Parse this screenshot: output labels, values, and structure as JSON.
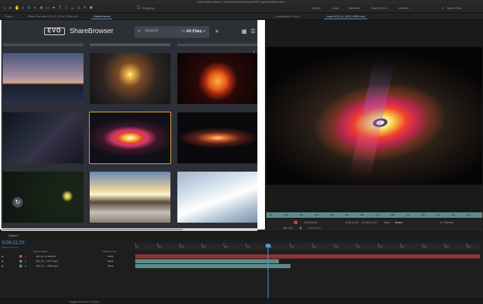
{
  "app": {
    "title": "Adobe After Effects - /Users/Andrew/Desktop/DNS Logo Animation.aep *"
  },
  "toolbar": {
    "snapping": "Snapping",
    "workspaces": [
      "Default",
      "Learn",
      "Standard",
      "Small Screen",
      "Libraries"
    ],
    "search_help": "Search Help"
  },
  "tabs": {
    "project": "Project",
    "effect_controls": "Effect Controls 003_01_4K19_0053.mp4",
    "sharebrowser": "ShareBrowser",
    "composition": "Composition Comp 1",
    "layer": "Layer 003_01_4K19_0053.mp4"
  },
  "sharebrowser": {
    "brand": "ShareBrowser",
    "logo_text": "EVO",
    "search_placeholder": "Search",
    "in_label": "In",
    "scope": "All Files"
  },
  "viewer": {
    "ruler": [
      "0s",
      "01s",
      "02s",
      "03s",
      "04s",
      "05s",
      "06s",
      "07s",
      "08s",
      "09s",
      "10s",
      "11s",
      "12s",
      "13s"
    ],
    "timecode_in": "0;00;00;00",
    "timecode_out": "0;00;11;20",
    "duration": "Δ 0;00;11;20",
    "view_label": "View:",
    "view_value": "Masks",
    "render_label": "Render",
    "zoom": "(66.7%)",
    "tc_bottom": "0;00;11;20"
  },
  "timeline": {
    "comp_tab": "Comp 1",
    "timecode": "0;00;11;20",
    "frames": "00350 (29.97 fps)",
    "headers": {
      "source": "Source Name",
      "parent": "Parent & Link"
    },
    "ruler": [
      "0s",
      "02s",
      "04s",
      "06s",
      "08s",
      "10s",
      "12s",
      "14s",
      "16s",
      "18s",
      "20s",
      "22s",
      "24s",
      "26s",
      "28s",
      "30s"
    ],
    "layers": [
      {
        "num": "1",
        "name": "sini_dr...rk solution",
        "parent": "None",
        "color": "#c94444"
      },
      {
        "num": "2",
        "name": "003_01_...0017.mp4",
        "parent": "None",
        "color": "#4a7f8a"
      },
      {
        "num": "3",
        "name": "003_01_...0053.mp4",
        "parent": "None",
        "color": "#4a7f8a"
      }
    ],
    "footer": "Toggle Switches / Modes"
  },
  "colors": {
    "accent": "#4d9bd6",
    "selection": "#e6b13a"
  }
}
